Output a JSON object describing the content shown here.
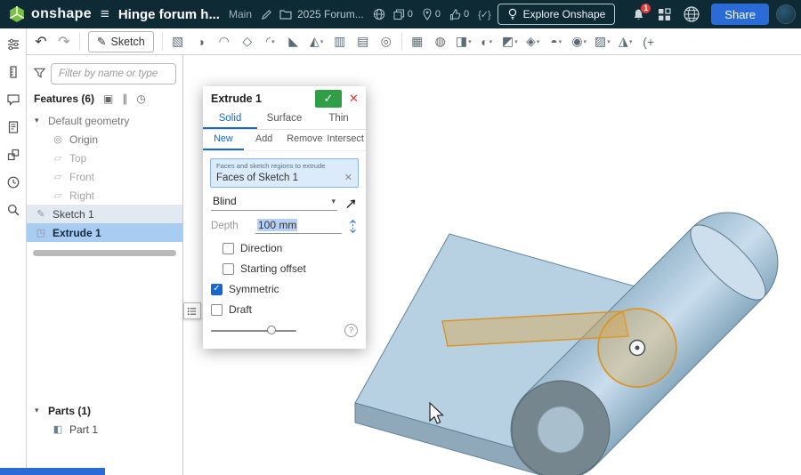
{
  "colors": {
    "header_bg": "#0d2a35",
    "accent_blue": "#1a66d1",
    "selection_blue": "#a9cdf2",
    "confirm_green": "#2f9e44",
    "close_red": "#d63d2e",
    "share_blue": "#2b6bd8",
    "part_blue": "#b7d1e3",
    "highlight_orange": "#d9952b"
  },
  "header": {
    "app_name": "onshape",
    "document_title": "Hinge forum h...",
    "workspace_label": "Main",
    "folder_label": "2025 Forum...",
    "copies_count": "0",
    "follows_count": "0",
    "likes_count": "0",
    "featurescript_icon": "{✓}",
    "explore_button_label": "Explore Onshape",
    "notification_badge": "1",
    "share_button_label": "Share"
  },
  "toolbar": {
    "sketch_label": "Sketch"
  },
  "feature_panel": {
    "filter_placeholder": "Filter by name or type",
    "features_header": "Features (6)",
    "tree": [
      {
        "label": "Default geometry",
        "type": "group",
        "expanded": true
      },
      {
        "label": "Origin",
        "type": "origin"
      },
      {
        "label": "Top",
        "type": "plane"
      },
      {
        "label": "Front",
        "type": "plane"
      },
      {
        "label": "Right",
        "type": "plane"
      },
      {
        "label": "Sketch 1",
        "type": "sketch",
        "selected": "secondary"
      },
      {
        "label": "Extrude 1",
        "type": "feature",
        "selected": "primary"
      }
    ],
    "parts_header": "Parts (1)",
    "parts": [
      {
        "label": "Part 1"
      }
    ]
  },
  "dialog": {
    "title": "Extrude 1",
    "tabs": [
      {
        "label": "Solid",
        "active": true
      },
      {
        "label": "Surface",
        "active": false
      },
      {
        "label": "Thin",
        "active": false
      }
    ],
    "operation_tabs": [
      {
        "label": "New",
        "active": true
      },
      {
        "label": "Add",
        "active": false
      },
      {
        "label": "Remove",
        "active": false
      },
      {
        "label": "Intersect",
        "active": false
      }
    ],
    "selection_caption": "Faces and sketch regions to extrude",
    "selection_value": "Faces of Sketch 1",
    "end_condition": "Blind",
    "depth_label": "Depth",
    "depth_value": "100 mm",
    "options": [
      {
        "label": "Direction",
        "checked": false,
        "indented": true
      },
      {
        "label": "Starting offset",
        "checked": false,
        "indented": true
      },
      {
        "label": "Symmetric",
        "checked": true,
        "indented": false
      },
      {
        "label": "Draft",
        "checked": false,
        "indented": false
      }
    ]
  }
}
